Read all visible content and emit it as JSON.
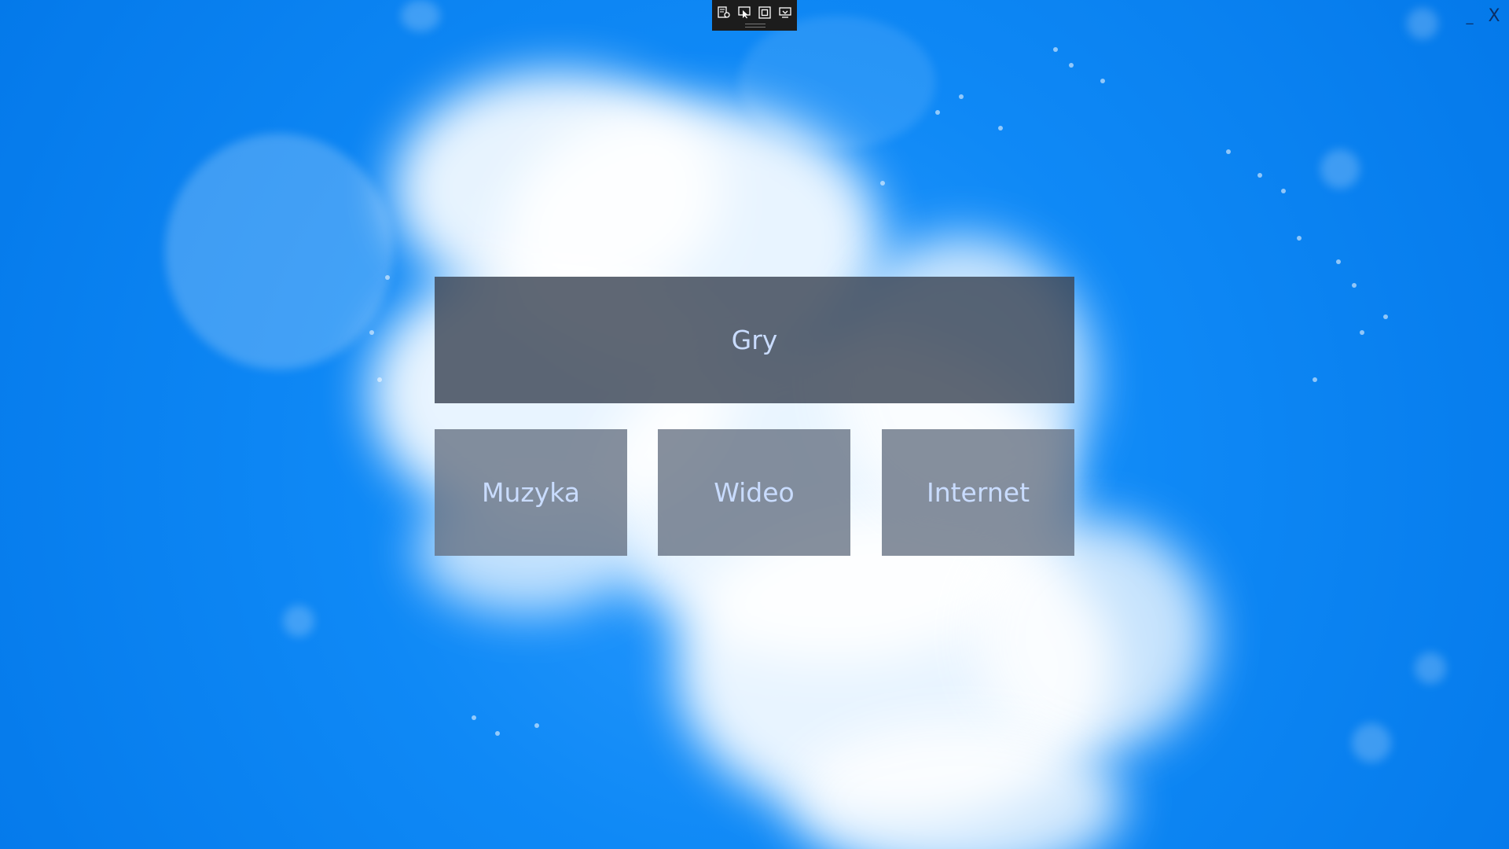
{
  "toolbar": {
    "icons": [
      "window-settings-icon",
      "pointer-select-icon",
      "fullscreen-icon",
      "screen-share-icon"
    ]
  },
  "window_controls": {
    "minimize": "_",
    "close": "X"
  },
  "tiles": {
    "main": "Gry",
    "items": [
      "Muzyka",
      "Wideo",
      "Internet"
    ]
  },
  "colors": {
    "background": "#0a86f5",
    "main_tile": "#3c4656",
    "small_tile": "#647082",
    "tile_text": "#c9dcff"
  }
}
